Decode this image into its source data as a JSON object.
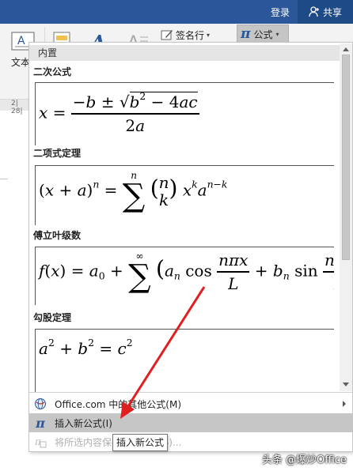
{
  "titlebar": {
    "signin_label": "登录",
    "share_label": "共享"
  },
  "ribbon": {
    "textbox_label": "文本",
    "signature_line_label": "签名行",
    "equation_label": "公式",
    "ruler_text": "2| 28|"
  },
  "gallery": {
    "section_header": "内置",
    "equations": [
      {
        "name": "二次公式"
      },
      {
        "name": "二项式定理"
      },
      {
        "name": "傅立叶级数"
      },
      {
        "name": "勾股定理"
      }
    ]
  },
  "menu": {
    "online_label": "Office.com 中的其他公式(M)",
    "insert_new_label": "插入新公式(I)",
    "save_selection_label": "将所选内容保存到公式库(S)..."
  },
  "tooltip": {
    "text": "插入新公式"
  },
  "watermark": {
    "text": "头条 @爆炒Office"
  },
  "colors": {
    "title_bar": "#2b579a",
    "accent_arrow": "#e02020",
    "highlight": "#c6c6c6"
  }
}
